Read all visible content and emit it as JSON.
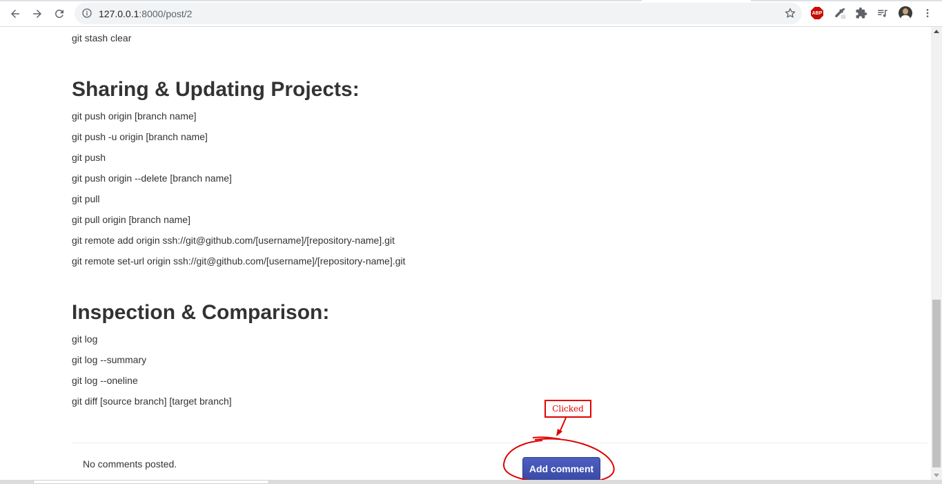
{
  "browser": {
    "url_host": "127.0.0.1",
    "url_rest": ":8000/post/2",
    "extensions": [
      "adblock-plus-icon",
      "eyedropper-icon",
      "extensions-puzzle-icon",
      "reading-list-icon",
      "profile-avatar"
    ]
  },
  "article": {
    "lines_top": [
      "git stash clear"
    ],
    "section_sharing": {
      "title": "Sharing & Updating Projects:",
      "commands": [
        "git push origin [branch name]",
        "git push -u origin [branch name]",
        "git push",
        "git push origin --delete [branch name]",
        "git pull",
        "git pull origin [branch name]",
        "git remote add origin ssh://git@github.com/[username]/[repository-name].git",
        "git remote set-url origin ssh://git@github.com/[username]/[repository-name].git"
      ]
    },
    "section_inspection": {
      "title": "Inspection & Comparison:",
      "commands": [
        "git log",
        "git log --summary",
        "git log --oneline",
        "git diff [source branch] [target branch]"
      ]
    }
  },
  "comments": {
    "empty_text": "No comments posted.",
    "add_button_label": "Add comment"
  },
  "annotation": {
    "label": "Clicked",
    "color": "#e00000"
  },
  "theme": {
    "button_color": "#3f51b5",
    "text_color": "#333333"
  }
}
